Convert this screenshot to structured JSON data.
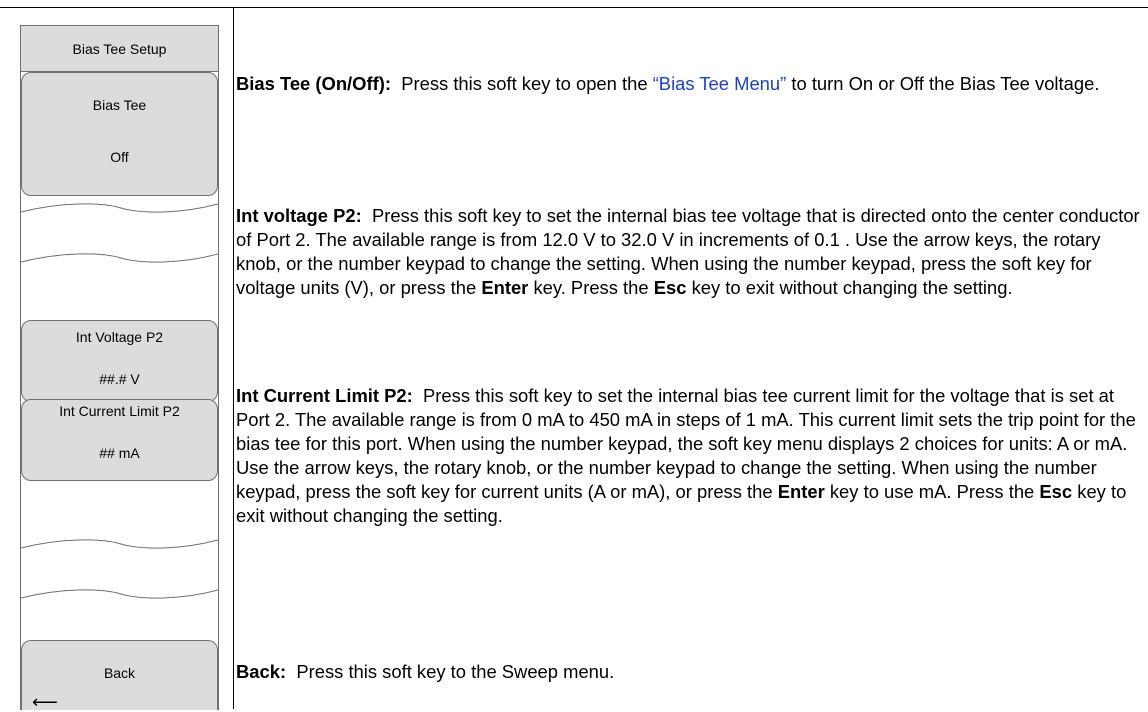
{
  "menu": {
    "title": "Bias Tee Setup",
    "keys": [
      {
        "line1": "Bias Tee",
        "line2": "Off"
      },
      {
        "line1": "Int Voltage P2",
        "line2": "##.# V"
      },
      {
        "line1": "Int Current Limit P2",
        "line2": "## mA"
      },
      {
        "line1": "Back",
        "line2": ""
      }
    ]
  },
  "descriptions": {
    "bias_tee": {
      "term": "Bias Tee (On/Off):",
      "before_link": "Press this soft key to open the ",
      "link": "“Bias Tee Menu”",
      "after_link": " to turn On or Off the Bias Tee voltage."
    },
    "int_voltage": {
      "term": "Int voltage P2:",
      "text1": "Press this soft key to set the internal bias tee voltage that is directed onto the center conductor of Port 2. The available range is from 12.0 V to 32.0 V in increments of 0.1 . Use the arrow keys, the rotary knob, or the number keypad to change the setting. When using the number keypad, press the soft key for voltage units (V), or press the ",
      "enter": "Enter",
      "text2": " key. Press the ",
      "esc": "Esc",
      "text3": " key to exit without changing the setting."
    },
    "int_current": {
      "term": "Int Current Limit P2:",
      "text1": "Press this soft key to set the internal bias tee current limit for the voltage that is set at Port 2. The available range is from 0 mA to 450 mA in steps of 1 mA. This current limit sets the trip point for the bias tee for this port. When using the number keypad, the soft key menu displays 2 choices for units:  A or mA. Use the arrow keys, the rotary knob, or the number keypad to change the setting. When using the number keypad, press the soft key for current units (A or mA), or press the ",
      "enter": "Enter",
      "text2": " key to use mA. Press the ",
      "esc": "Esc",
      "text3": " key to exit without changing the setting."
    },
    "back": {
      "term": "Back:",
      "text": "Press this soft key to the Sweep menu."
    }
  }
}
